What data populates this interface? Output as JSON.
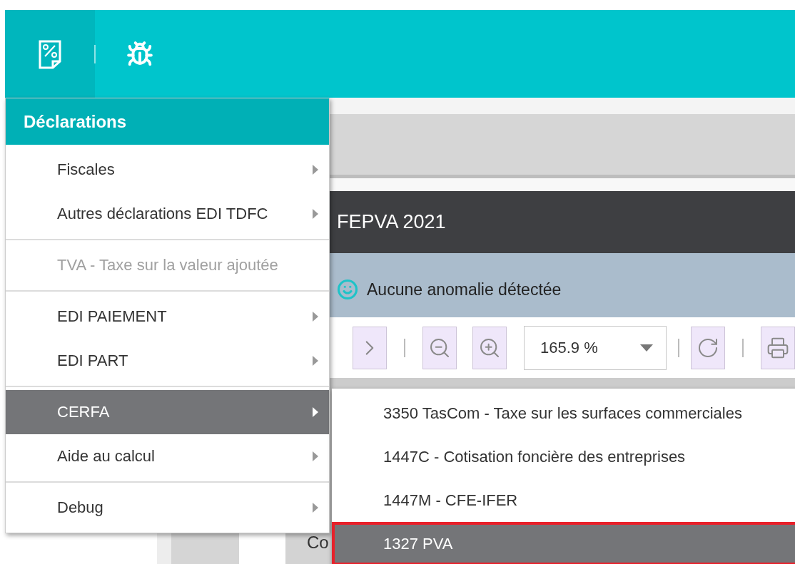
{
  "topbar": {
    "tools": [
      {
        "selected": true
      },
      {
        "selected": false
      }
    ]
  },
  "document": {
    "title": "FEPVA 2021",
    "status": "Aucune anomalie détectée",
    "zoom": "165.9 %",
    "table_fragment": "Co"
  },
  "menu": {
    "title": "Déclarations",
    "groups": [
      [
        {
          "label": "Fiscales",
          "has_submenu": true,
          "disabled": false,
          "selected": false
        },
        {
          "label": "Autres déclarations EDI TDFC",
          "has_submenu": true,
          "disabled": false,
          "selected": false
        }
      ],
      [
        {
          "label": "TVA - Taxe sur la valeur ajoutée",
          "has_submenu": false,
          "disabled": true,
          "selected": false
        }
      ],
      [
        {
          "label": "EDI PAIEMENT",
          "has_submenu": true,
          "disabled": false,
          "selected": false
        },
        {
          "label": "EDI PART",
          "has_submenu": true,
          "disabled": false,
          "selected": false
        }
      ],
      [
        {
          "label": "CERFA",
          "has_submenu": true,
          "disabled": false,
          "selected": true
        },
        {
          "label": "Aide au calcul",
          "has_submenu": true,
          "disabled": false,
          "selected": false
        }
      ],
      [
        {
          "label": "Debug",
          "has_submenu": true,
          "disabled": false,
          "selected": false
        }
      ]
    ]
  },
  "submenu": {
    "items": [
      {
        "label": "3350 TasCom - Taxe sur les surfaces commerciales",
        "selected": false,
        "highlighted": false
      },
      {
        "label": "1447C - Cotisation foncière des entreprises",
        "selected": false,
        "highlighted": false
      },
      {
        "label": "1447M - CFE-IFER",
        "selected": false,
        "highlighted": false
      },
      {
        "label": "1327 PVA",
        "selected": true,
        "highlighted": true
      }
    ]
  }
}
